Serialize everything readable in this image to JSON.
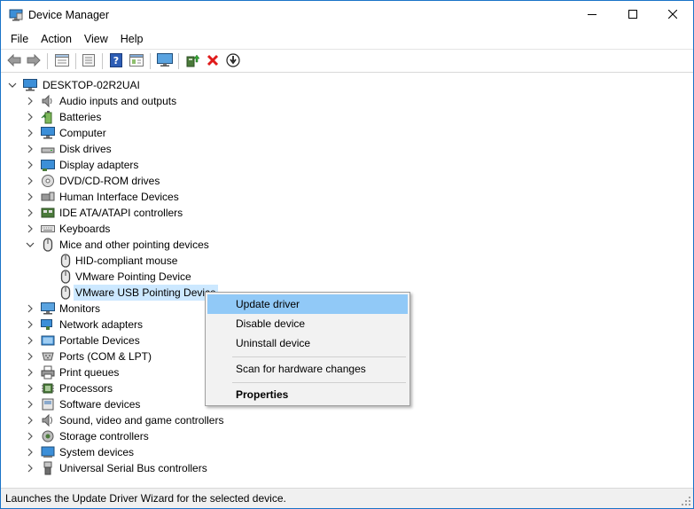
{
  "window": {
    "title": "Device Manager"
  },
  "menubar": {
    "items": [
      "File",
      "Action",
      "View",
      "Help"
    ]
  },
  "toolbar": {
    "buttons": [
      "back-icon",
      "forward-icon",
      "properties-icon",
      "show-hide-icon",
      "help-icon",
      "device-view-icon",
      "monitor-icon",
      "update-driver-icon",
      "uninstall-icon",
      "download-icon"
    ]
  },
  "tree": {
    "root": "DESKTOP-02R2UAI",
    "categories": [
      {
        "label": "Audio inputs and outputs",
        "icon": "speaker-icon"
      },
      {
        "label": "Batteries",
        "icon": "battery-icon"
      },
      {
        "label": "Computer",
        "icon": "computer-icon"
      },
      {
        "label": "Disk drives",
        "icon": "disk-drive-icon"
      },
      {
        "label": "Display adapters",
        "icon": "display-adapter-icon"
      },
      {
        "label": "DVD/CD-ROM drives",
        "icon": "dvd-drive-icon"
      },
      {
        "label": "Human Interface Devices",
        "icon": "hid-icon"
      },
      {
        "label": "IDE ATA/ATAPI controllers",
        "icon": "ide-controller-icon"
      },
      {
        "label": "Keyboards",
        "icon": "keyboard-icon"
      },
      {
        "label": "Mice and other pointing devices",
        "icon": "mouse-icon"
      },
      {
        "label": "Monitors",
        "icon": "monitor-icon"
      },
      {
        "label": "Network adapters",
        "icon": "network-adapter-icon"
      },
      {
        "label": "Portable Devices",
        "icon": "portable-device-icon"
      },
      {
        "label": "Ports (COM & LPT)",
        "icon": "port-icon"
      },
      {
        "label": "Print queues",
        "icon": "printer-icon"
      },
      {
        "label": "Processors",
        "icon": "processor-icon"
      },
      {
        "label": "Software devices",
        "icon": "software-device-icon"
      },
      {
        "label": "Sound, video and game controllers",
        "icon": "sound-icon"
      },
      {
        "label": "Storage controllers",
        "icon": "storage-controller-icon"
      },
      {
        "label": "System devices",
        "icon": "system-device-icon"
      },
      {
        "label": "Universal Serial Bus controllers",
        "icon": "usb-icon"
      }
    ],
    "mice_children": [
      "HID-compliant mouse",
      "VMware Pointing Device",
      "VMware USB Pointing Device"
    ]
  },
  "context_menu": {
    "update_driver": "Update driver",
    "disable_device": "Disable device",
    "uninstall_device": "Uninstall device",
    "scan": "Scan for hardware changes",
    "properties": "Properties"
  },
  "statusbar": {
    "text": "Launches the Update Driver Wizard for the selected device."
  },
  "colors": {
    "selection": "#cce8ff",
    "menu_highlight": "#91c9f7",
    "window_border": "#1a73c8"
  }
}
